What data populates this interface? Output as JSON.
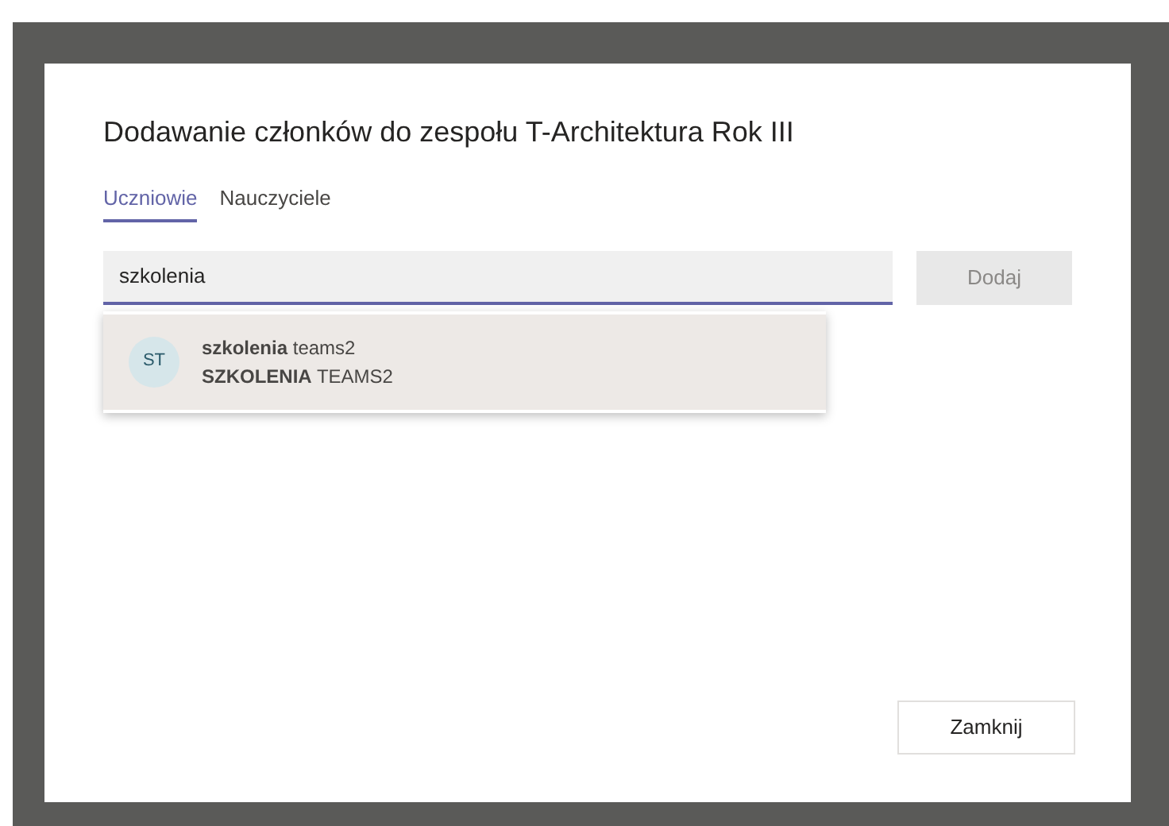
{
  "dialog": {
    "title": "Dodawanie członków do zespołu T-Architektura Rok III",
    "tabs": [
      {
        "label": "Uczniowie",
        "selected": true
      },
      {
        "label": "Nauczyciele",
        "selected": false
      }
    ],
    "search": {
      "value": "szkolenia"
    },
    "add_button": {
      "label": "Dodaj",
      "disabled": true
    },
    "suggestions": [
      {
        "initials": "ST",
        "name": "**szkolenia** teams2",
        "email": "**SZKOLENIA** TEAMS2",
        "selected": true
      }
    ],
    "close_button": {
      "label": "Zamknij"
    }
  }
}
